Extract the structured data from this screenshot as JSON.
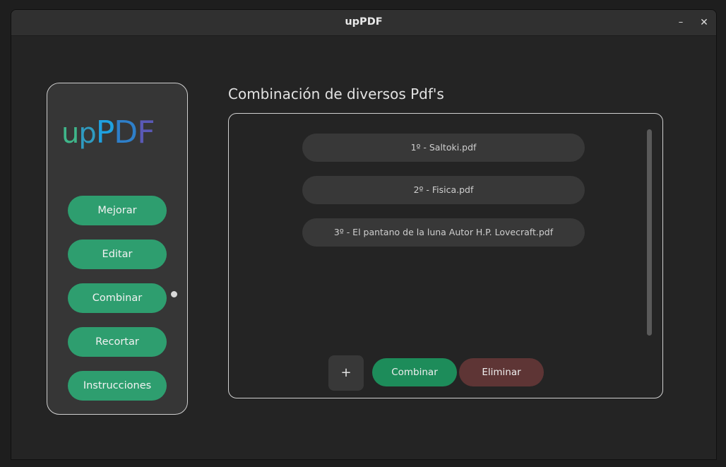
{
  "window": {
    "title": "upPDF",
    "minimize_label": "–",
    "close_label": "✕"
  },
  "sidebar": {
    "logo": {
      "part1": "u",
      "part2": "p",
      "part3": "P",
      "part4": "D",
      "part5": "F"
    },
    "items": [
      {
        "label": "Mejorar"
      },
      {
        "label": "Editar"
      },
      {
        "label": "Combinar",
        "active": true
      },
      {
        "label": "Recortar"
      },
      {
        "label": "Instrucciones"
      }
    ]
  },
  "main": {
    "heading": "Combinación de diversos Pdf's",
    "files": [
      {
        "label": "1º - Saltoki.pdf"
      },
      {
        "label": "2º - Fisica.pdf"
      },
      {
        "label": "3º - El pantano de la luna Autor H.P. Lovecraft.pdf"
      }
    ],
    "add_label": "+",
    "combine_label": "Combinar",
    "delete_label": "Eliminar"
  },
  "colors": {
    "accent_green": "#2e9e6f",
    "combine_green": "#1d8c5a",
    "delete_red": "#5e3535",
    "background": "#242424"
  }
}
